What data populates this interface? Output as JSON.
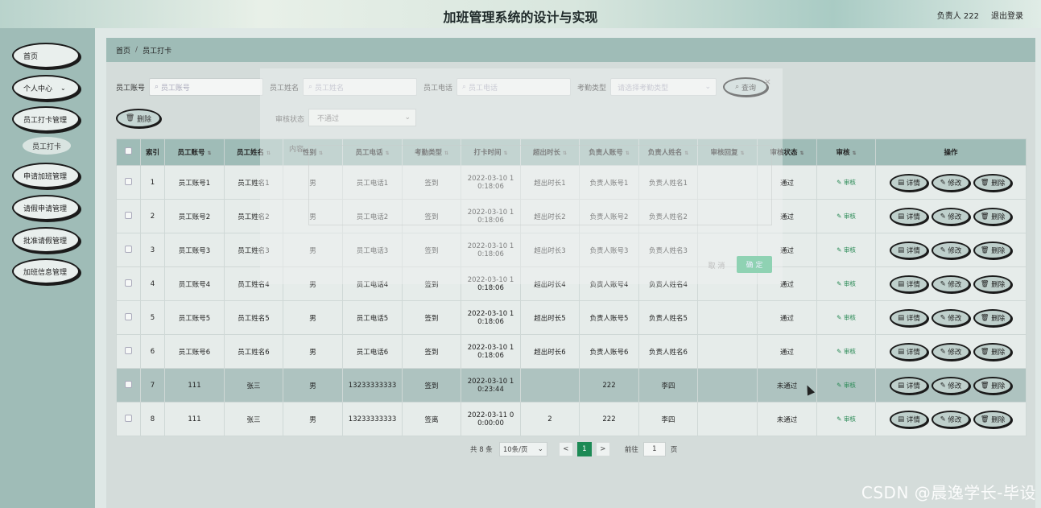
{
  "header": {
    "title": "加班管理系统的设计与实现",
    "user": "负责人 222",
    "logout": "退出登录"
  },
  "sidebar": {
    "items": [
      {
        "label": "首页"
      },
      {
        "label": "个人中心",
        "chev": "⌄"
      },
      {
        "label": "员工打卡管理"
      },
      {
        "label": "申请加班管理"
      },
      {
        "label": "请假申请管理"
      },
      {
        "label": "批准请假管理"
      },
      {
        "label": "加班信息管理"
      }
    ],
    "sub": "员工打卡"
  },
  "breadcrumb": {
    "home": "首页",
    "sep": "/",
    "current": "员工打卡"
  },
  "search": {
    "acct_label": "员工账号",
    "acct_placeholder": "员工账号",
    "name_label": "员工姓名",
    "name_placeholder": "员工姓名",
    "phone_label": "员工电话",
    "phone_placeholder": "员工电话",
    "type_label": "考勤类型",
    "type_placeholder": "请选择考勤类型",
    "query": "查询"
  },
  "toolbar": {
    "delete": "删除"
  },
  "modal": {
    "status_label": "审核状态",
    "status_value": "不通过",
    "content_label": "内容",
    "cancel": "取 消",
    "ok": "确 定",
    "close": "×"
  },
  "table": {
    "headers": [
      "索引",
      "员工账号",
      "员工姓名",
      "性别",
      "员工电话",
      "考勤类型",
      "打卡时间",
      "超出时长",
      "负责人账号",
      "负责人姓名",
      "审核回复",
      "审核状态",
      "审核",
      "操作"
    ],
    "rows": [
      {
        "idx": "1",
        "acct": "员工账号1",
        "name": "员工姓名1",
        "sex": "男",
        "phone": "员工电话1",
        "type": "签到",
        "time1": "2022-03-10 1",
        "time2": "0:18:06",
        "over": "超出时长1",
        "macct": "负责人账号1",
        "mname": "负责人姓名1",
        "reply": "",
        "status": "通过"
      },
      {
        "idx": "2",
        "acct": "员工账号2",
        "name": "员工姓名2",
        "sex": "男",
        "phone": "员工电话2",
        "type": "签到",
        "time1": "2022-03-10 1",
        "time2": "0:18:06",
        "over": "超出时长2",
        "macct": "负责人账号2",
        "mname": "负责人姓名2",
        "reply": "",
        "status": "通过"
      },
      {
        "idx": "3",
        "acct": "员工账号3",
        "name": "员工姓名3",
        "sex": "男",
        "phone": "员工电话3",
        "type": "签到",
        "time1": "2022-03-10 1",
        "time2": "0:18:06",
        "over": "超出时长3",
        "macct": "负责人账号3",
        "mname": "负责人姓名3",
        "reply": "",
        "status": "通过"
      },
      {
        "idx": "4",
        "acct": "员工账号4",
        "name": "员工姓名4",
        "sex": "男",
        "phone": "员工电话4",
        "type": "签到",
        "time1": "2022-03-10 1",
        "time2": "0:18:06",
        "over": "超出时长4",
        "macct": "负责人账号4",
        "mname": "负责人姓名4",
        "reply": "",
        "status": "通过"
      },
      {
        "idx": "5",
        "acct": "员工账号5",
        "name": "员工姓名5",
        "sex": "男",
        "phone": "员工电话5",
        "type": "签到",
        "time1": "2022-03-10 1",
        "time2": "0:18:06",
        "over": "超出时长5",
        "macct": "负责人账号5",
        "mname": "负责人姓名5",
        "reply": "",
        "status": "通过"
      },
      {
        "idx": "6",
        "acct": "员工账号6",
        "name": "员工姓名6",
        "sex": "男",
        "phone": "员工电话6",
        "type": "签到",
        "time1": "2022-03-10 1",
        "time2": "0:18:06",
        "over": "超出时长6",
        "macct": "负责人账号6",
        "mname": "负责人姓名6",
        "reply": "",
        "status": "通过"
      },
      {
        "idx": "7",
        "acct": "111",
        "name": "张三",
        "sex": "男",
        "phone": "13233333333",
        "type": "签到",
        "time1": "2022-03-10 1",
        "time2": "0:23:44",
        "over": "",
        "macct": "222",
        "mname": "李四",
        "reply": "",
        "status": "未通过"
      },
      {
        "idx": "8",
        "acct": "111",
        "name": "张三",
        "sex": "男",
        "phone": "13233333333",
        "type": "签离",
        "time1": "2022-03-11 0",
        "time2": "0:00:00",
        "over": "2",
        "macct": "222",
        "mname": "李四",
        "reply": "",
        "status": "未通过"
      }
    ],
    "audit_label": "审核",
    "op_detail": "详情",
    "op_edit": "修改",
    "op_delete": "删除"
  },
  "pager": {
    "total": "共 8 条",
    "size": "10条/页",
    "prev": "<",
    "page": "1",
    "next": ">",
    "goto": "前往",
    "goto_value": "1",
    "page_unit": "页"
  },
  "watermark": "CSDN @晨逸学长-毕设"
}
